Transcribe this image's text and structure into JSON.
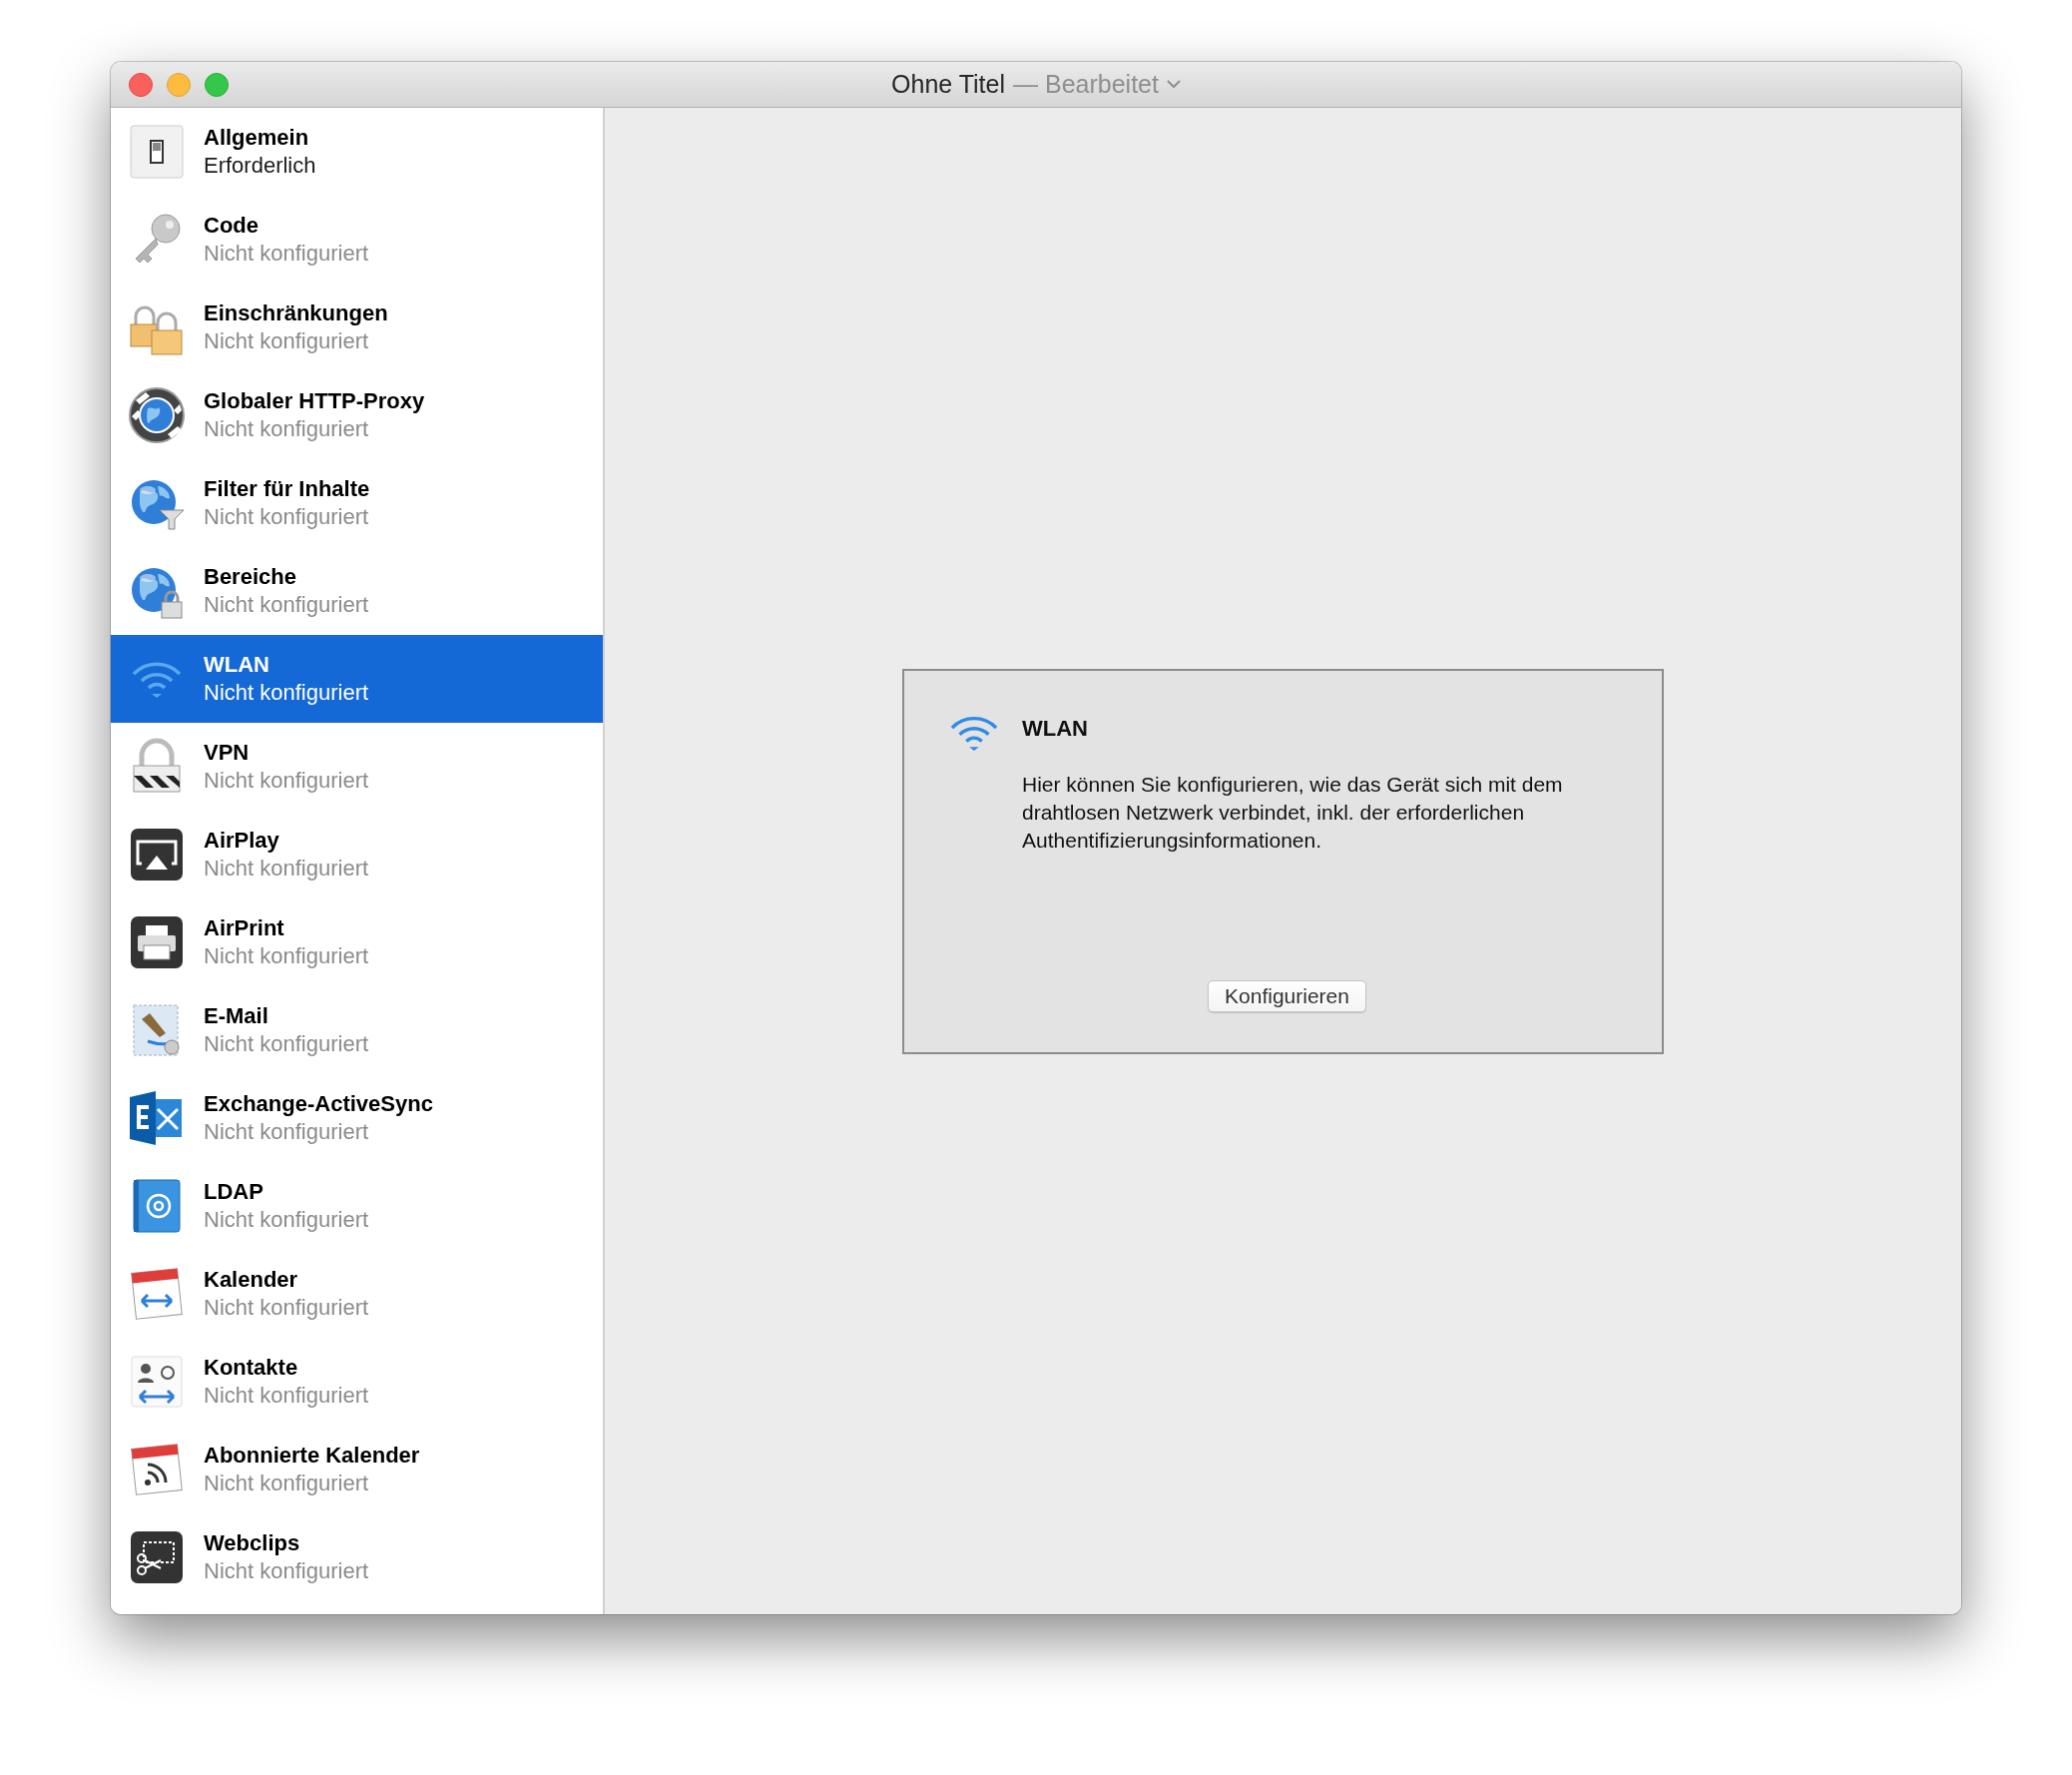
{
  "window": {
    "title": "Ohne Titel",
    "status": "— Bearbeitet"
  },
  "sidebar": {
    "items": [
      {
        "title": "Allgemein",
        "subtitle": "Erforderlich",
        "required": true,
        "selected": false
      },
      {
        "title": "Code",
        "subtitle": "Nicht konfiguriert",
        "required": false,
        "selected": false
      },
      {
        "title": "Einschränkungen",
        "subtitle": "Nicht konfiguriert",
        "required": false,
        "selected": false
      },
      {
        "title": "Globaler HTTP-Proxy",
        "subtitle": "Nicht konfiguriert",
        "required": false,
        "selected": false
      },
      {
        "title": "Filter für Inhalte",
        "subtitle": "Nicht konfiguriert",
        "required": false,
        "selected": false
      },
      {
        "title": "Bereiche",
        "subtitle": "Nicht konfiguriert",
        "required": false,
        "selected": false
      },
      {
        "title": "WLAN",
        "subtitle": "Nicht konfiguriert",
        "required": false,
        "selected": true
      },
      {
        "title": "VPN",
        "subtitle": "Nicht konfiguriert",
        "required": false,
        "selected": false
      },
      {
        "title": "AirPlay",
        "subtitle": "Nicht konfiguriert",
        "required": false,
        "selected": false
      },
      {
        "title": "AirPrint",
        "subtitle": "Nicht konfiguriert",
        "required": false,
        "selected": false
      },
      {
        "title": "E-Mail",
        "subtitle": "Nicht konfiguriert",
        "required": false,
        "selected": false
      },
      {
        "title": "Exchange-ActiveSync",
        "subtitle": "Nicht konfiguriert",
        "required": false,
        "selected": false
      },
      {
        "title": "LDAP",
        "subtitle": "Nicht konfiguriert",
        "required": false,
        "selected": false
      },
      {
        "title": "Kalender",
        "subtitle": "Nicht konfiguriert",
        "required": false,
        "selected": false
      },
      {
        "title": "Kontakte",
        "subtitle": "Nicht konfiguriert",
        "required": false,
        "selected": false
      },
      {
        "title": "Abonnierte Kalender",
        "subtitle": "Nicht konfiguriert",
        "required": false,
        "selected": false
      },
      {
        "title": "Webclips",
        "subtitle": "Nicht konfiguriert",
        "required": false,
        "selected": false
      }
    ]
  },
  "panel": {
    "title": "WLAN",
    "description": "Hier können Sie konfigurieren, wie das Gerät sich mit dem drahtlosen Netzwerk verbindet, inkl. der erforderlichen Authentifizierungsinformationen.",
    "button": "Konfigurieren"
  }
}
